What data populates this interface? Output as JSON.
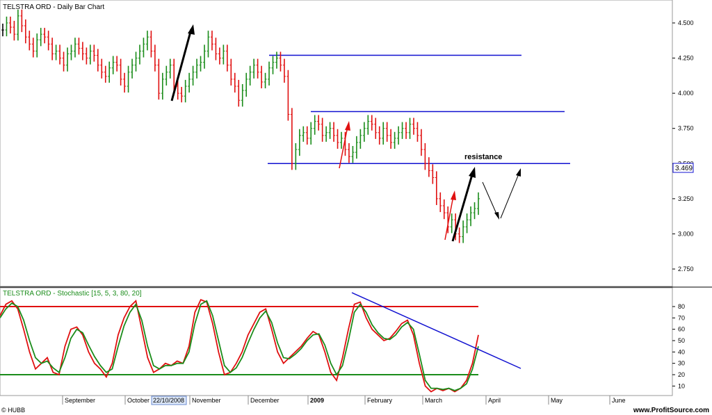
{
  "colors": {
    "up_bar": "#1a8c1a",
    "down_bar": "#e01010",
    "neutral_bar": "#000000",
    "level_line": "#1010d0",
    "stoch_k": "#e01010",
    "stoch_d": "#1a8c1a",
    "over_bought": "#e01010",
    "over_sold": "#1a8c1a"
  },
  "price_panel": {
    "title": "TELSTRA ORD - Daily Bar Chart",
    "last_price_label": "3.469",
    "annotation": "resistance"
  },
  "stoch_panel": {
    "title": "TELSTRA ORD - Stochastic [15, 5, 3, 80, 20]"
  },
  "footer": {
    "left": "© HUBB",
    "right": "www.ProfitSource.com",
    "cursor_date": "22/10/2008"
  },
  "chart_data": [
    {
      "type": "bar",
      "title": "TELSTRA ORD - Daily Bar Chart",
      "ylim": [
        2.6,
        4.6
      ],
      "y_ticks": [
        "4.500",
        "4.250",
        "4.000",
        "3.750",
        "3.500",
        "3.250",
        "3.000",
        "2.750"
      ],
      "x_ticks": [
        "September",
        "October",
        "November",
        "December",
        "2009",
        "February",
        "March",
        "April",
        "May",
        "June"
      ],
      "bars_close": [
        4.45,
        4.5,
        4.47,
        4.42,
        4.55,
        4.48,
        4.4,
        4.35,
        4.3,
        4.38,
        4.42,
        4.4,
        4.35,
        4.28,
        4.3,
        4.25,
        4.2,
        4.28,
        4.3,
        4.35,
        4.32,
        4.28,
        4.25,
        4.3,
        4.27,
        4.2,
        4.15,
        4.12,
        4.18,
        4.22,
        4.2,
        4.1,
        4.05,
        4.15,
        4.2,
        4.25,
        4.3,
        4.35,
        4.4,
        4.3,
        4.2,
        4.0,
        4.1,
        4.15,
        4.2,
        4.05,
        4.0,
        3.98,
        4.05,
        4.1,
        4.15,
        4.2,
        4.22,
        4.3,
        4.4,
        4.35,
        4.28,
        4.25,
        4.3,
        4.2,
        4.1,
        4.05,
        3.95,
        4.02,
        4.1,
        4.15,
        4.2,
        4.15,
        4.08,
        4.1,
        4.18,
        4.22,
        4.25,
        4.2,
        4.12,
        3.85,
        3.5,
        3.6,
        3.7,
        3.72,
        3.68,
        3.75,
        3.8,
        3.78,
        3.7,
        3.72,
        3.75,
        3.7,
        3.65,
        3.68,
        3.6,
        3.55,
        3.58,
        3.65,
        3.7,
        3.75,
        3.8,
        3.78,
        3.72,
        3.68,
        3.75,
        3.7,
        3.65,
        3.68,
        3.72,
        3.75,
        3.72,
        3.78,
        3.75,
        3.7,
        3.6,
        3.5,
        3.45,
        3.4,
        3.25,
        3.2,
        3.15,
        3.05,
        3.1,
        3.0,
        2.98,
        3.05,
        3.1,
        3.15,
        3.18,
        3.25
      ],
      "levels": [
        4.27,
        3.87,
        3.5
      ]
    },
    {
      "type": "line",
      "title": "TELSTRA ORD - Stochastic [15, 5, 3, 80, 20]",
      "ylim": [
        0,
        90
      ],
      "y_ticks": [
        "80",
        "70",
        "60",
        "50",
        "40",
        "30",
        "20",
        "10"
      ],
      "overbought": 80,
      "oversold": 20,
      "series": [
        {
          "name": "%K",
          "values": [
            72,
            82,
            85,
            78,
            60,
            40,
            25,
            30,
            35,
            22,
            20,
            45,
            60,
            62,
            55,
            40,
            30,
            25,
            18,
            30,
            55,
            70,
            80,
            85,
            60,
            35,
            22,
            25,
            30,
            28,
            32,
            30,
            45,
            75,
            86,
            84,
            65,
            40,
            20,
            22,
            30,
            40,
            55,
            65,
            75,
            78,
            60,
            40,
            30,
            35,
            40,
            45,
            52,
            58,
            55,
            40,
            22,
            15,
            35,
            60,
            82,
            84,
            70,
            60,
            55,
            50,
            52,
            58,
            65,
            68,
            55,
            30,
            10,
            5,
            8,
            6,
            8,
            5,
            8,
            15,
            30,
            55
          ]
        },
        {
          "name": "%D",
          "values": [
            70,
            78,
            83,
            80,
            68,
            50,
            35,
            30,
            32,
            26,
            22,
            35,
            52,
            60,
            57,
            46,
            36,
            28,
            22,
            25,
            45,
            63,
            75,
            82,
            68,
            45,
            28,
            25,
            28,
            28,
            30,
            30,
            40,
            65,
            82,
            85,
            72,
            50,
            28,
            22,
            26,
            35,
            48,
            60,
            70,
            76,
            66,
            48,
            35,
            34,
            38,
            43,
            50,
            55,
            56,
            46,
            30,
            20,
            28,
            50,
            75,
            82,
            75,
            64,
            57,
            52,
            51,
            55,
            62,
            66,
            60,
            38,
            15,
            8,
            8,
            7,
            8,
            6,
            8,
            12,
            25,
            45
          ]
        }
      ]
    }
  ]
}
